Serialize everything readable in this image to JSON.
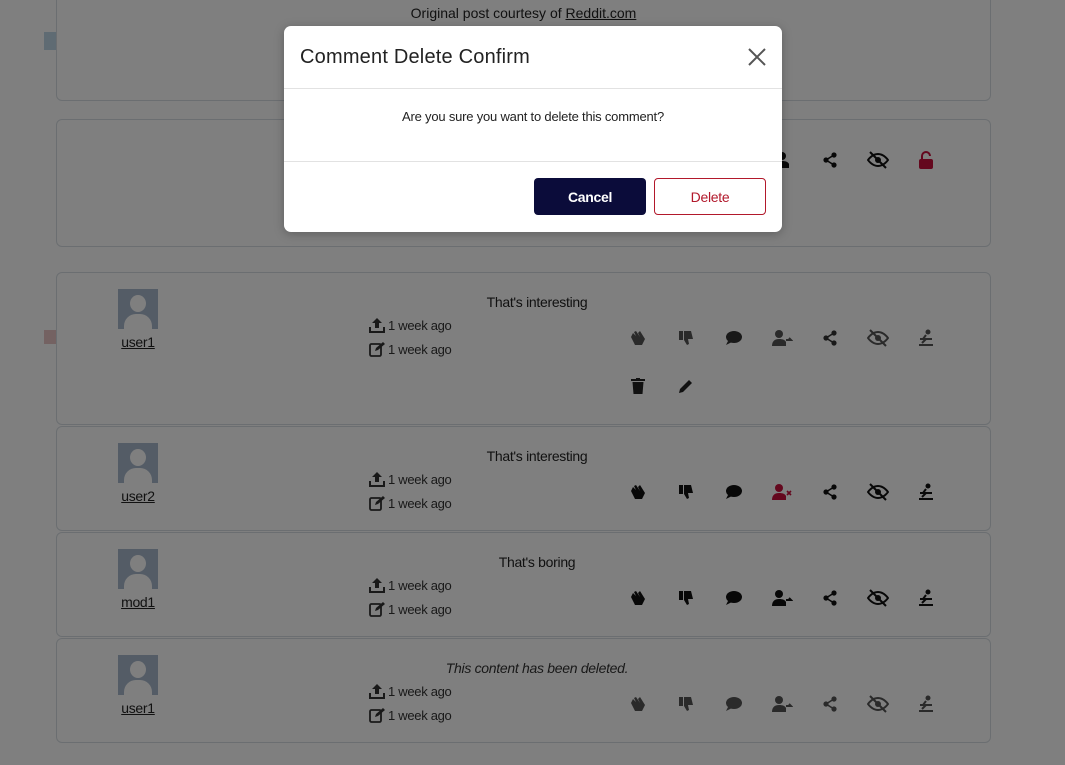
{
  "post": {
    "courtesy_prefix": "Original post courtesy of ",
    "courtesy_link": "Reddit.com"
  },
  "comments": [
    {
      "username": "user1",
      "text": "That's interesting",
      "created": "1 week ago",
      "edited": "1 week ago",
      "deleted": false,
      "owner": true
    },
    {
      "username": "user2",
      "text": "That's interesting",
      "created": "1 week ago",
      "edited": "1 week ago",
      "deleted": false,
      "owner": false
    },
    {
      "username": "mod1",
      "text": "That's boring",
      "created": "1 week ago",
      "edited": "1 week ago",
      "deleted": false,
      "owner": false
    },
    {
      "username": "user1",
      "text": "This content has been deleted.",
      "created": "1 week ago",
      "edited": "1 week ago",
      "deleted": true,
      "owner": true
    }
  ],
  "modal": {
    "title": "Comment Delete Confirm",
    "body": "Are you sure you want to delete this comment?",
    "cancel_label": "Cancel",
    "delete_label": "Delete"
  },
  "icons": {
    "upload": "upload-icon",
    "edit": "edit-icon",
    "clap": "clap-icon",
    "thumbs_down": "thumbs-down-icon",
    "reply": "comment-bubble-icon",
    "follow": "user-follow-icon",
    "unfollow": "user-unfollow-icon",
    "share": "share-icon",
    "hide": "eye-slash-icon",
    "report": "report-icon",
    "delete": "trash-icon",
    "pencil": "pencil-icon",
    "lock": "unlock-icon",
    "close": "close-icon"
  },
  "colors": {
    "accent_dark": "#0b0c3a",
    "danger": "#b2182b",
    "unfollow_red": "#c8103c"
  }
}
